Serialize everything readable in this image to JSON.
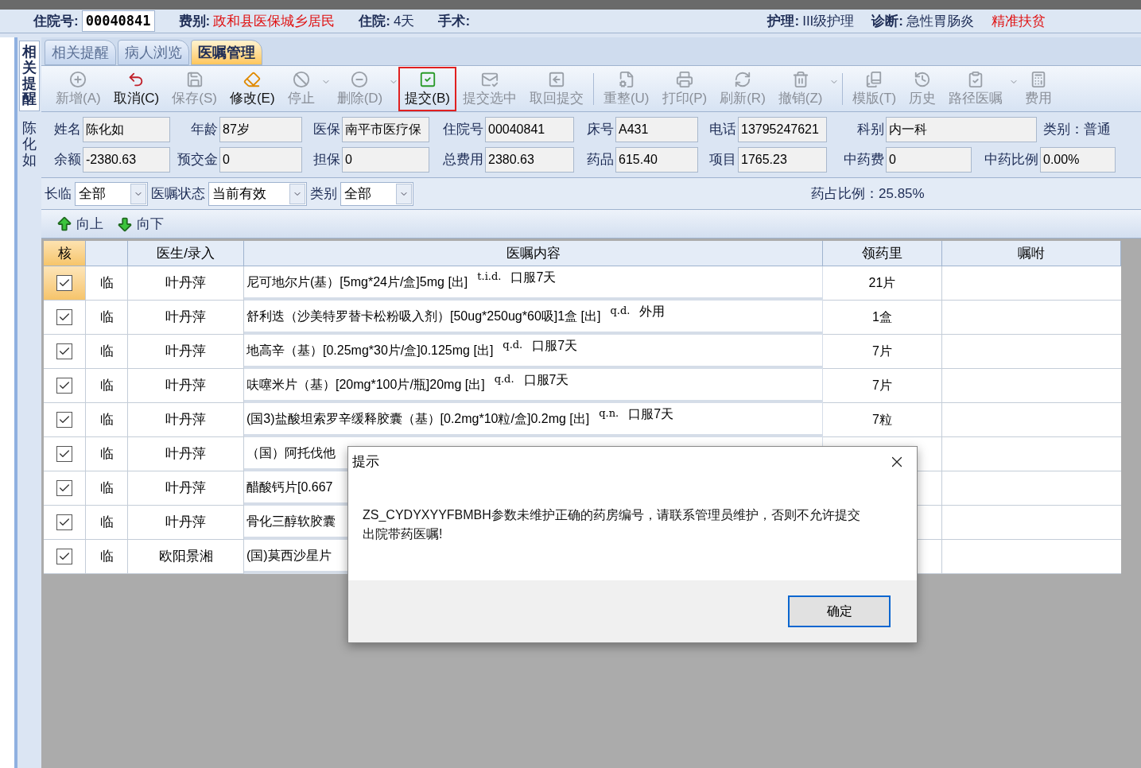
{
  "header": {
    "fields": [
      {
        "label": "住院号:",
        "value": "00040841",
        "kind": "box"
      },
      {
        "label": "费别:",
        "value": "政和县医保城乡居民",
        "kind": "alert"
      },
      {
        "label": "住院:",
        "value": "4天",
        "kind": "plain"
      },
      {
        "label": "手术:"
      }
    ],
    "right_fields": [
      {
        "label": "护理:",
        "value": "III级护理",
        "kind": "plain"
      },
      {
        "label": "诊断:",
        "value": "急性胃肠炎",
        "kind": "plain"
      },
      {
        "value": "精准扶贫",
        "kind": "alert"
      }
    ]
  },
  "side_tabs": [
    {
      "label": "相关提醒",
      "selected": true
    },
    {
      "label": "陈化如",
      "selected": false
    }
  ],
  "tabs": [
    {
      "label": "相关提醒",
      "selected": false
    },
    {
      "label": "病人浏览",
      "selected": false
    },
    {
      "label": "医嘱管理",
      "selected": true
    }
  ],
  "toolbar": [
    {
      "label": "新增(A)",
      "disabled": true,
      "dropdown": false,
      "separator_before": false,
      "highlighted": false
    },
    {
      "label": "取消(C)",
      "disabled": false,
      "dropdown": false,
      "separator_before": false,
      "highlighted": false
    },
    {
      "label": "保存(S)",
      "disabled": true,
      "dropdown": false,
      "separator_before": false,
      "highlighted": false
    },
    {
      "label": "修改(E)",
      "disabled": false,
      "dropdown": false,
      "separator_before": false,
      "highlighted": false
    },
    {
      "label": "停止",
      "disabled": true,
      "dropdown": true,
      "separator_before": false,
      "highlighted": false
    },
    {
      "label": "删除(D)",
      "disabled": true,
      "dropdown": true,
      "separator_before": false,
      "highlighted": false
    },
    {
      "label": "提交(B)",
      "disabled": false,
      "dropdown": false,
      "separator_before": false,
      "highlighted": true
    },
    {
      "label": "提交选中",
      "disabled": true,
      "dropdown": false,
      "separator_before": false,
      "highlighted": false
    },
    {
      "label": "取回提交",
      "disabled": true,
      "dropdown": false,
      "separator_before": false,
      "highlighted": false
    },
    {
      "label": "重整(U)",
      "disabled": true,
      "dropdown": false,
      "separator_before": true,
      "highlighted": false
    },
    {
      "label": "打印(P)",
      "disabled": true,
      "dropdown": false,
      "separator_before": false,
      "highlighted": false
    },
    {
      "label": "刷新(R)",
      "disabled": true,
      "dropdown": false,
      "separator_before": false,
      "highlighted": false
    },
    {
      "label": "撤销(Z)",
      "disabled": true,
      "dropdown": true,
      "separator_before": false,
      "highlighted": false
    },
    {
      "label": "模版(T)",
      "disabled": true,
      "dropdown": false,
      "separator_before": true,
      "highlighted": false
    },
    {
      "label": "历史",
      "disabled": true,
      "dropdown": false,
      "separator_before": false,
      "highlighted": false
    },
    {
      "label": "路径医嘱",
      "disabled": true,
      "dropdown": true,
      "separator_before": false,
      "highlighted": false
    },
    {
      "label": "费用",
      "disabled": true,
      "dropdown": false,
      "separator_before": false,
      "highlighted": false
    }
  ],
  "patient_info": [
    [
      {
        "label": "姓名",
        "value": "陈化如"
      },
      {
        "label": "年龄",
        "value": "87岁"
      },
      {
        "label": "医保",
        "value": "南平市医疗保"
      },
      {
        "label": "住院号",
        "value": "00040841"
      },
      {
        "label": "床号",
        "value": "A431"
      },
      {
        "label": "电话",
        "value": "13795247621"
      },
      {
        "label": "科别",
        "value": "内一科"
      },
      {
        "label": "类别：",
        "value": "普通",
        "kind": "text"
      }
    ],
    [
      {
        "label": "余额",
        "value": "-2380.63"
      },
      {
        "label": "预交金",
        "value": "0"
      },
      {
        "label": "担保",
        "value": "0"
      },
      {
        "label": "总费用",
        "value": "2380.63"
      },
      {
        "label": "药品",
        "value": "615.40"
      },
      {
        "label": "项目",
        "value": "1765.23"
      },
      {
        "label": "中药费",
        "value": "0"
      },
      {
        "label": "中药比例",
        "value": "0.00%"
      }
    ]
  ],
  "filters": [
    {
      "label": "长临",
      "value": "全部"
    },
    {
      "label": "医嘱状态",
      "value": "当前有效"
    },
    {
      "label": "类别",
      "value": "全部"
    }
  ],
  "drug_ratio": "药占比例：25.85%",
  "move_buttons": [
    {
      "label": "向上",
      "kind": "up"
    },
    {
      "label": "向下",
      "kind": "down"
    }
  ],
  "table": {
    "columns": [
      "核",
      "",
      "医生/录入",
      "医嘱内容",
      "领药里",
      "嘱咐"
    ],
    "rows": [
      {
        "checked": true,
        "selected": true,
        "type": "临",
        "doctor": "叶丹萍",
        "content": "尼可地尔片(基）[5mg*24片/盒]5mg [出]",
        "frequency": "t.i.d.",
        "usage": "口服7天",
        "quantity": "21片"
      },
      {
        "checked": true,
        "selected": false,
        "type": "临",
        "doctor": "叶丹萍",
        "content": "舒利迭（沙美特罗替卡松粉吸入剂）[50ug*250ug*60吸]1盒 [出]",
        "frequency": "q.d.",
        "usage": "外用",
        "quantity": "1盒"
      },
      {
        "checked": true,
        "selected": false,
        "type": "临",
        "doctor": "叶丹萍",
        "content": "地高辛（基）[0.25mg*30片/盒]0.125mg [出]",
        "frequency": "q.d.",
        "usage": "口服7天",
        "quantity": "7片"
      },
      {
        "checked": true,
        "selected": false,
        "type": "临",
        "doctor": "叶丹萍",
        "content": "呋噻米片（基）[20mg*100片/瓶]20mg [出]",
        "frequency": "q.d.",
        "usage": "口服7天",
        "quantity": "7片"
      },
      {
        "checked": true,
        "selected": false,
        "type": "临",
        "doctor": "叶丹萍",
        "content": "(国3)盐酸坦索罗辛缓释胶囊（基）[0.2mg*10粒/盒]0.2mg [出]",
        "frequency": "q.n.",
        "usage": "口服7天",
        "quantity": "7粒"
      },
      {
        "checked": true,
        "selected": false,
        "type": "临",
        "doctor": "叶丹萍",
        "content": "（国）阿托伐他"
      },
      {
        "checked": true,
        "selected": false,
        "type": "临",
        "doctor": "叶丹萍",
        "content": "醋酸钙片[0.667"
      },
      {
        "checked": true,
        "selected": false,
        "type": "临",
        "doctor": "叶丹萍",
        "content": "骨化三醇软胶囊"
      },
      {
        "checked": true,
        "selected": false,
        "type": "临",
        "doctor": "欧阳景湘",
        "content": "(国)莫西沙星片"
      }
    ]
  },
  "dialog": {
    "title": "提示",
    "message": "ZS_CYDYXYYFBMBH参数未维护正确的药房编号，请联系管理员维护，否则不允许提交出院带药医嘱!",
    "button": "确定"
  }
}
